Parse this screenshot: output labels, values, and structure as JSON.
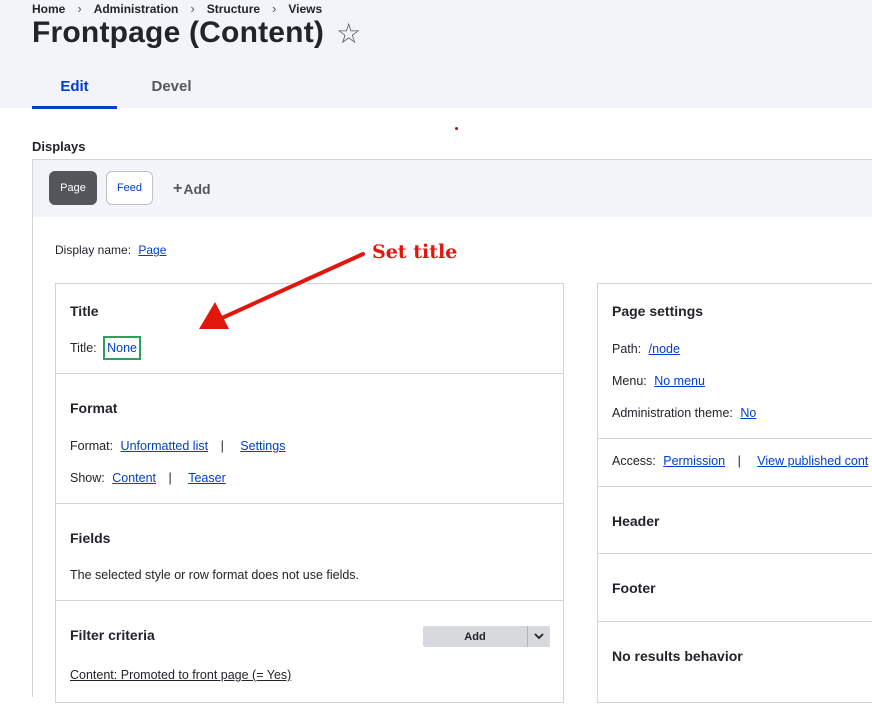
{
  "breadcrumb": [
    "Home",
    "Administration",
    "Structure",
    "Views"
  ],
  "breadcrumb_sep": "›",
  "page": {
    "title": "Frontpage (Content)",
    "star": "☆"
  },
  "tabs": [
    "Edit",
    "Devel"
  ],
  "displays": {
    "label": "Displays",
    "items": [
      "Page",
      "Feed"
    ],
    "add_plus": "+",
    "add_label": "Add"
  },
  "display_name": {
    "label": "Display name:",
    "value": "Page"
  },
  "annotation": {
    "text": "Set title",
    "color": "#e1170e"
  },
  "left": {
    "title_section": {
      "heading": "Title",
      "label": "Title:",
      "value": "None"
    },
    "format_section": {
      "heading": "Format",
      "format_label": "Format:",
      "format_value": "Unformatted list",
      "settings": "Settings",
      "show_label": "Show:",
      "show_value": "Content",
      "teaser": "Teaser",
      "pipe": "|"
    },
    "fields_section": {
      "heading": "Fields",
      "text": "The selected style or row format does not use fields."
    },
    "filter_section": {
      "heading": "Filter criteria",
      "add": "Add",
      "item": "Content: Promoted to front page (= Yes)"
    }
  },
  "right": {
    "page_settings": {
      "heading": "Page settings",
      "path_label": "Path:",
      "path_value": "/node",
      "menu_label": "Menu:",
      "menu_value": "No menu",
      "admin_label": "Administration theme:",
      "admin_value": "No"
    },
    "access": {
      "label": "Access:",
      "value": "Permission",
      "pipe": "|",
      "view_published": "View published cont"
    },
    "header": {
      "heading": "Header"
    },
    "footer": {
      "heading": "Footer"
    },
    "no_results": {
      "heading": "No results behavior"
    }
  },
  "colors": {
    "link": "#003ecc",
    "accent_green": "#2fa05a",
    "header_bg": "#f3f4f9"
  }
}
